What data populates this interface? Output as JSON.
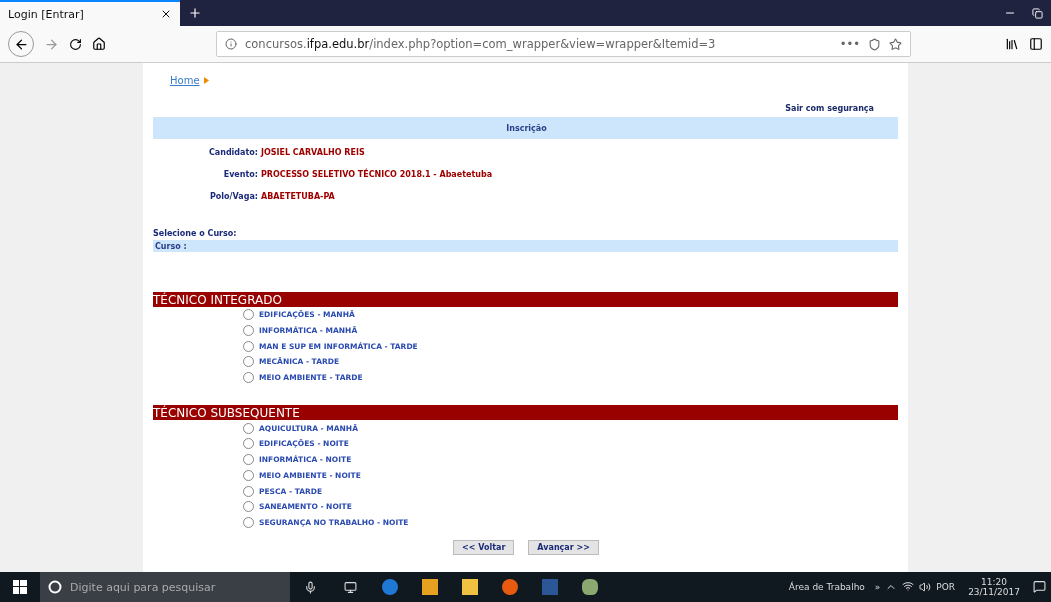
{
  "browser": {
    "tab": {
      "title": "Login [Entrar]",
      "selected": true
    },
    "url_prefix": "concursos.",
    "url_domain": "ifpa.edu.br",
    "url_path": "/index.php?option=com_wrapper&view=wrapper&Itemid=3",
    "menu_dots": "•••"
  },
  "breadcrumb": "Home",
  "logout": "Sair com segurança",
  "header": "Inscrição",
  "info": [
    {
      "label": "Candidato:",
      "value": "JOSIEL CARVALHO REIS"
    },
    {
      "label": "Evento:",
      "value": "PROCESSO SELETIVO TÉCNICO 2018.1 - Abaetetuba"
    },
    {
      "label": "Polo/Vaga:",
      "value": "ABAETETUBA-PA"
    }
  ],
  "select_label": "Selecione o Curso:",
  "course_bar": "Curso :",
  "groups": [
    {
      "title": "TÉCNICO INTEGRADO",
      "options": [
        {
          "label": "EDIFICAÇÕES - MANHÃ",
          "selected": false
        },
        {
          "label": "INFORMÁTICA - MANHÃ",
          "selected": false
        },
        {
          "label": "MAN E SUP EM INFORMÁTICA - TARDE",
          "selected": false
        },
        {
          "label": "MECÂNICA - TARDE",
          "selected": false
        },
        {
          "label": "MEIO AMBIENTE - TARDE",
          "selected": false
        }
      ]
    },
    {
      "title": "TÉCNICO SUBSEQUENTE",
      "options": [
        {
          "label": "AQUICULTURA - MANHÃ",
          "selected": false
        },
        {
          "label": "EDIFICAÇÕES - NOITE",
          "selected": false
        },
        {
          "label": "INFORMÁTICA - NOITE",
          "selected": false
        },
        {
          "label": "MEIO AMBIENTE - NOITE",
          "selected": false
        },
        {
          "label": "PESCA - TARDE",
          "selected": false
        },
        {
          "label": "SANEAMENTO - NOITE",
          "selected": false
        },
        {
          "label": "SEGURANÇA NO TRABALHO - NOITE",
          "selected": false
        }
      ]
    }
  ],
  "buttons": [
    "<< Voltar",
    "Avançar >>"
  ],
  "taskbar": {
    "search_placeholder": "Digite aqui para pesquisar",
    "desktop_label": "Área de Trabalho",
    "chevron": "»",
    "language": "POR",
    "time": "11:20",
    "date": "23/11/2017"
  }
}
